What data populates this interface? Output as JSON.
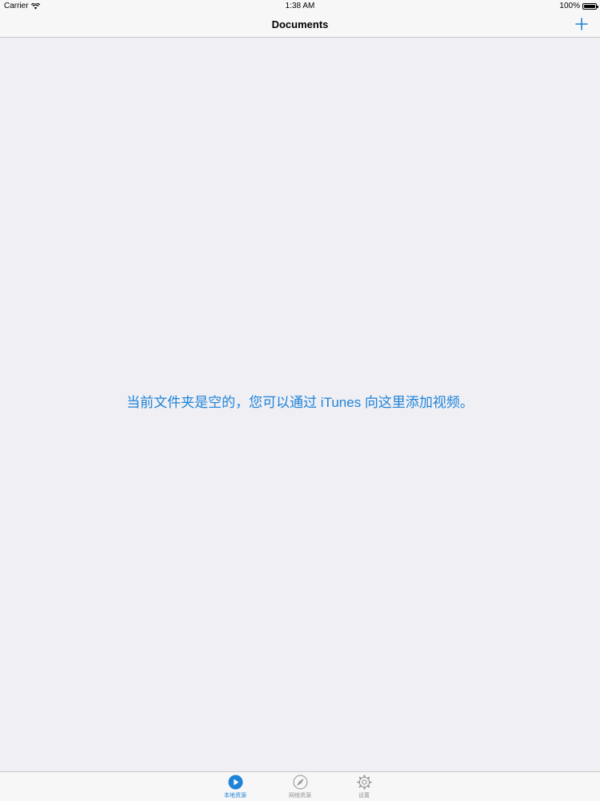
{
  "status_bar": {
    "carrier": "Carrier",
    "time": "1:38 AM",
    "battery": "100%"
  },
  "nav": {
    "title": "Documents",
    "add_icon": "plus-icon"
  },
  "main": {
    "empty_message": "当前文件夹是空的，您可以通过 iTunes 向这里添加视频。"
  },
  "tabs": [
    {
      "label": "本地资源",
      "icon": "play-circle-icon",
      "active": true
    },
    {
      "label": "网络资源",
      "icon": "compass-icon",
      "active": false
    },
    {
      "label": "设置",
      "icon": "gear-icon",
      "active": false
    }
  ],
  "colors": {
    "accent": "#1f83d8",
    "background": "#efeff4",
    "bar": "#f7f7f7",
    "inactive": "#929292"
  }
}
